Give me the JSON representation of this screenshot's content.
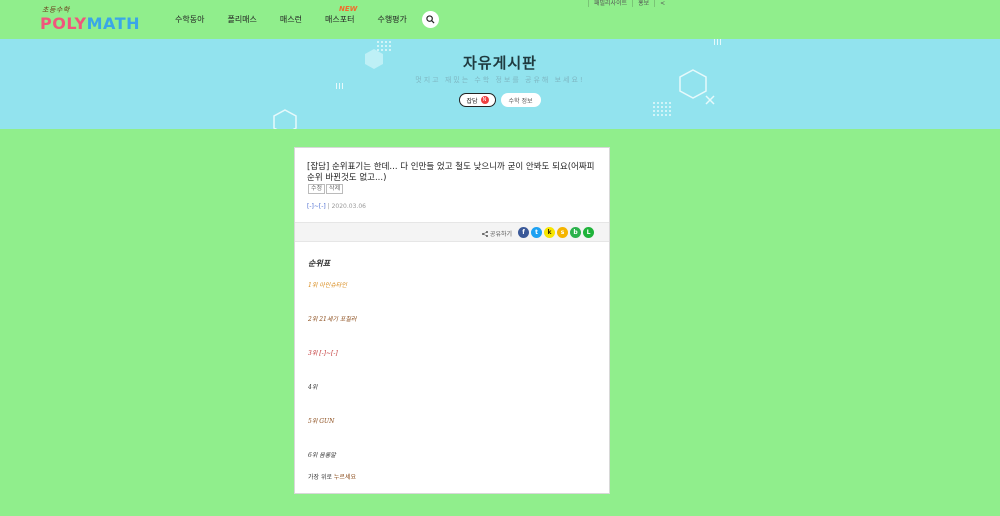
{
  "header": {
    "logo_small": "초등수학",
    "logo_poly": "POLY",
    "logo_math": "MATH",
    "nav": [
      {
        "label": "수학동아",
        "badge": ""
      },
      {
        "label": "폴리매스",
        "badge": ""
      },
      {
        "label": "매스런",
        "badge": ""
      },
      {
        "label": "매스포터",
        "badge": "NEW"
      },
      {
        "label": "수행평가",
        "badge": ""
      }
    ],
    "topbar": [
      "패밀리사이트",
      "홍보",
      "<"
    ]
  },
  "banner": {
    "title": "자유게시판",
    "subtitle": "멋지고 재밌는 수학 정보를 공유해 보세요!",
    "pills": [
      {
        "label": "잡담",
        "count": "N"
      },
      {
        "label": "수학 정보"
      }
    ]
  },
  "post": {
    "title": "[잡담] 순위표기는 한데... 다 인만들 었고 철도 낮으니까 굳이 안봐도 되요(어짜피 순위 바뀐것도 없고...)",
    "tags": [
      "수정",
      "삭제"
    ],
    "author": "[-]~[-]",
    "date": "2020.03.06",
    "share_label": "공유하기",
    "share_icons": [
      {
        "name": "facebook",
        "glyph": "f",
        "color": "#3b5998"
      },
      {
        "name": "twitter",
        "glyph": "t",
        "color": "#1da1f2"
      },
      {
        "name": "kakaotalk",
        "glyph": "k",
        "color": "#3a2a00"
      },
      {
        "name": "kakaostory",
        "glyph": "s",
        "color": "#f5b400"
      },
      {
        "name": "band",
        "glyph": "b",
        "color": "#2bb24c"
      },
      {
        "name": "line",
        "glyph": "L",
        "color": "#1fb33a"
      }
    ],
    "body_heading": "순위표",
    "body_lines": [
      {
        "text": "1위 아인슈타인",
        "color": "#d88a1a"
      },
      {
        "text": "2위 21세기 포칠러",
        "color": "#8a4a18"
      },
      {
        "text": "3위 [-]~[-]",
        "color": "#c03030"
      },
      {
        "text": "4위",
        "color": "#333333"
      },
      {
        "text": "5위 GUN",
        "color": "#8a4a18"
      },
      {
        "text": "6위 음롱말",
        "color": "#333333"
      }
    ],
    "last_line_prefix": "가장 위로 ",
    "last_line_highlight": "누르세요"
  }
}
